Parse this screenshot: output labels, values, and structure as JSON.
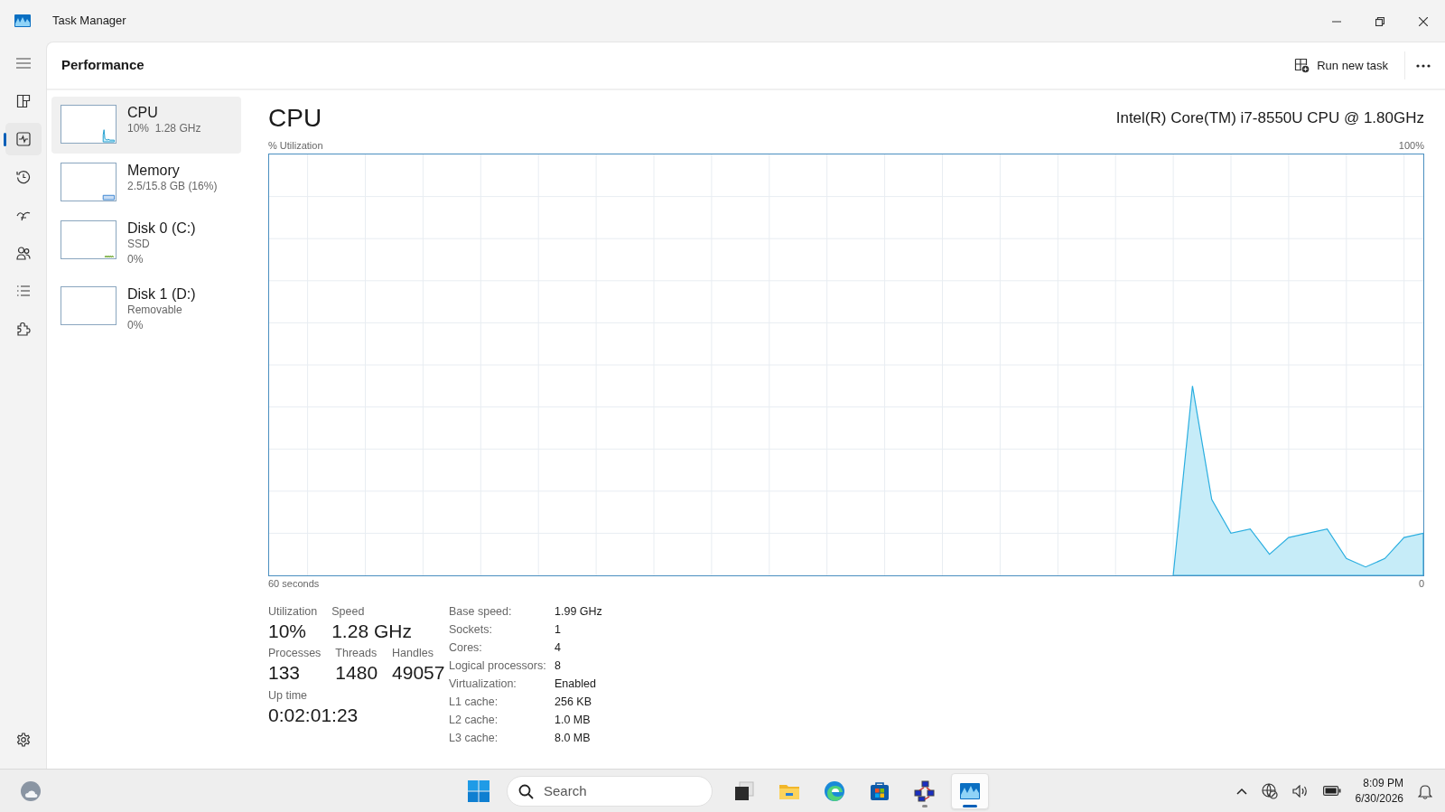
{
  "window": {
    "title": "Task Manager"
  },
  "nav": {
    "pages": [
      {
        "selected": false
      },
      {
        "selected": true
      },
      {
        "selected": false
      },
      {
        "selected": false
      },
      {
        "selected": false
      },
      {
        "selected": false
      },
      {
        "selected": false
      }
    ]
  },
  "header": {
    "title": "Performance",
    "run_task": "Run new task"
  },
  "devices": [
    {
      "kind": "cpu",
      "name": "CPU",
      "details": [
        "10%  1.28 GHz"
      ],
      "selected": true
    },
    {
      "kind": "memory",
      "name": "Memory",
      "details": [
        "2.5/15.8 GB (16%)"
      ],
      "selected": false
    },
    {
      "kind": "disk",
      "name": "Disk 0 (C:)",
      "details": [
        "SSD",
        "0%"
      ],
      "selected": false
    },
    {
      "kind": "idle",
      "name": "Disk 1 (D:)",
      "details": [
        "Removable",
        "0%"
      ],
      "selected": false
    }
  ],
  "detail": {
    "title": "CPU",
    "model": "Intel(R) Core(TM) i7-8550U CPU @ 1.80GHz",
    "graph": {
      "axis_title": "% Utilization",
      "top_label": "100%",
      "left_label": "60 seconds",
      "right_label": "0"
    },
    "stats": [
      [
        {
          "label": "Utilization",
          "value": "10%"
        },
        {
          "label": "Speed",
          "value": "1.28 GHz"
        }
      ],
      [
        {
          "label": "Processes",
          "value": "133"
        },
        {
          "label": "Threads",
          "value": "1480"
        },
        {
          "label": "Handles",
          "value": "49057"
        }
      ],
      [
        {
          "label": "Up time",
          "value": "0:02:01:23"
        }
      ]
    ],
    "specs": [
      {
        "label": "Base speed:",
        "value": "1.99 GHz"
      },
      {
        "label": "Sockets:",
        "value": "1"
      },
      {
        "label": "Cores:",
        "value": "4"
      },
      {
        "label": "Logical processors:",
        "value": "8"
      },
      {
        "label": "Virtualization:",
        "value": "Enabled"
      },
      {
        "label": "L1 cache:",
        "value": "256 KB"
      },
      {
        "label": "L2 cache:",
        "value": "1.0 MB"
      },
      {
        "label": "L3 cache:",
        "value": "8.0 MB"
      }
    ]
  },
  "taskbar": {
    "search_placeholder": "Search",
    "apps": [
      {
        "kind": "taskview",
        "selected": false,
        "running": false
      },
      {
        "kind": "folder",
        "selected": false,
        "running": false
      },
      {
        "kind": "browser",
        "selected": false,
        "running": false
      },
      {
        "kind": "store",
        "selected": false,
        "running": false
      },
      {
        "kind": "network",
        "selected": false,
        "running": true
      },
      {
        "kind": "monitor",
        "selected": true,
        "running": true
      }
    ],
    "time": "8:09 PM",
    "date": "6/30/2026"
  }
}
